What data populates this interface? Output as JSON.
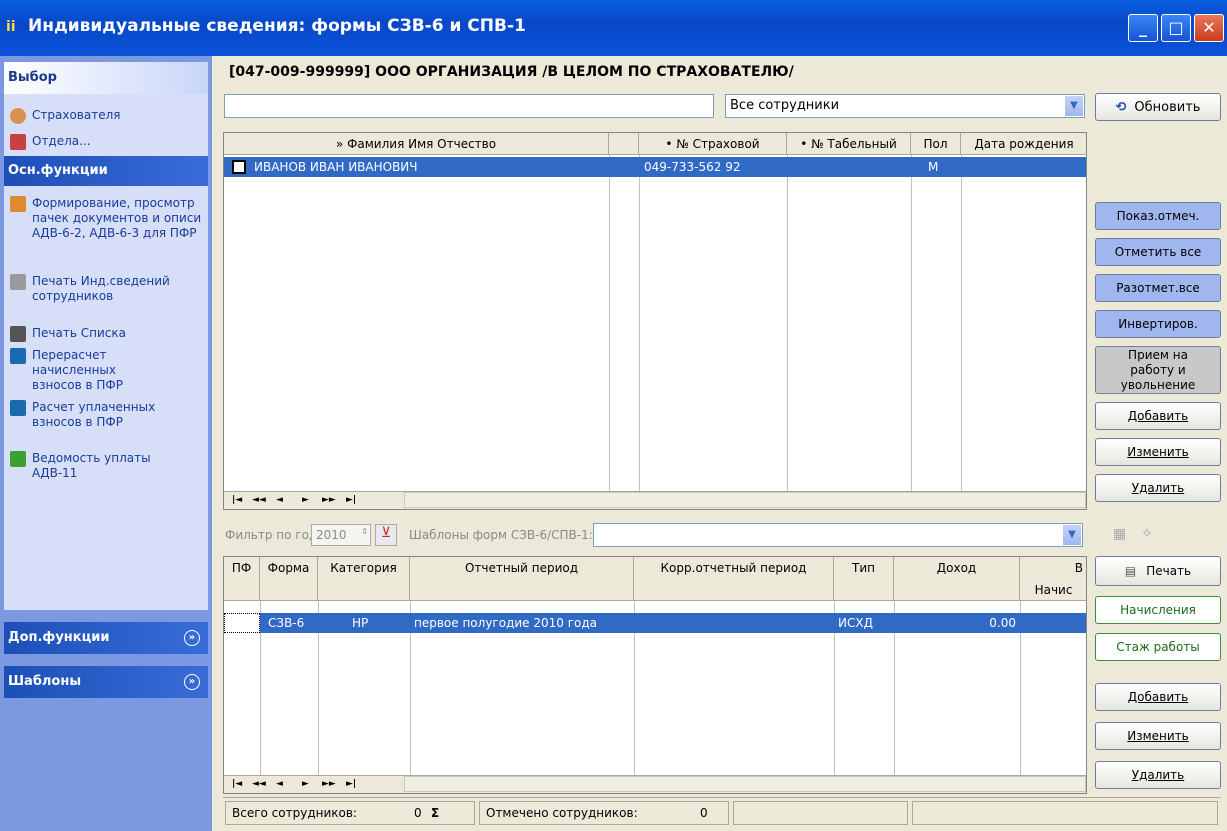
{
  "window": {
    "title": "Индивидуальные сведения: формы СЗВ-6 и СПВ-1"
  },
  "left_pane": {
    "select_header": "Выбор",
    "select_items": [
      "Страхователя",
      "Отдела..."
    ],
    "main_header": "Осн.функции",
    "main_items": [
      "Формирование, просмотр пачек документов и описи АДВ-6-2, АДВ-6-3 для ПФР",
      "Печать Инд.сведений сотрудников",
      "Печать Списка",
      "Перерасчет начисленных взносов в ПФР",
      "Расчет уплаченных взносов в ПФР",
      "Ведомость уплаты АДВ-11"
    ],
    "extra_header": "Доп.функции",
    "templates_header": "Шаблоны"
  },
  "org_title": "[047-009-999999] ООО ОРГАНИЗАЦИЯ /В ЦЕЛОМ ПО СТРАХОВАТЕЛЮ/",
  "filter": {
    "employees": "Все сотрудники",
    "refresh": "Обновить"
  },
  "employees_grid": {
    "headers": [
      "» Фамилия Имя Отчество",
      "• № Страховой",
      "• № Табельный",
      "Пол",
      "Дата рождения"
    ],
    "rows": [
      {
        "name": "ИВАНОВ ИВАН ИВАНОВИЧ",
        "snils": "049-733-562 92",
        "tab": "",
        "sex": "М",
        "dob": ""
      }
    ]
  },
  "right_buttons_top": {
    "show_marked": "Показ.отмеч.",
    "mark_all": "Отметить все",
    "unmark_all": "Разотмет.все",
    "invert": "Инвертиров.",
    "hire": "Прием на работу и увольнение",
    "add": "Добавить",
    "edit": "Изменить",
    "delete": "Удалить"
  },
  "year_filter": {
    "label": "Фильтр по году:",
    "year": "2010",
    "templates_label": "Шаблоны форм СЗВ-6/СПВ-1:"
  },
  "forms_grid": {
    "headers": [
      "ПФ",
      "Форма",
      "Категория",
      "Отчетный период",
      "Корр.отчетный период",
      "Тип",
      "Доход",
      "В",
      "Начис"
    ],
    "rows": [
      {
        "form": "СЗВ-6",
        "cat": "НР",
        "period": "первое полугодие 2010 года",
        "corr": "",
        "type": "ИСХД",
        "income": "0.00"
      }
    ]
  },
  "right_buttons_bottom": {
    "print": "Печать",
    "accruals": "Начисления",
    "experience": "Стаж работы",
    "add": "Добавить",
    "edit": "Изменить",
    "delete": "Удалить"
  },
  "status": {
    "total_label": "Всего сотрудников:",
    "total_value": "0",
    "marked_label": "Отмечено сотрудников:",
    "marked_value": "0"
  }
}
